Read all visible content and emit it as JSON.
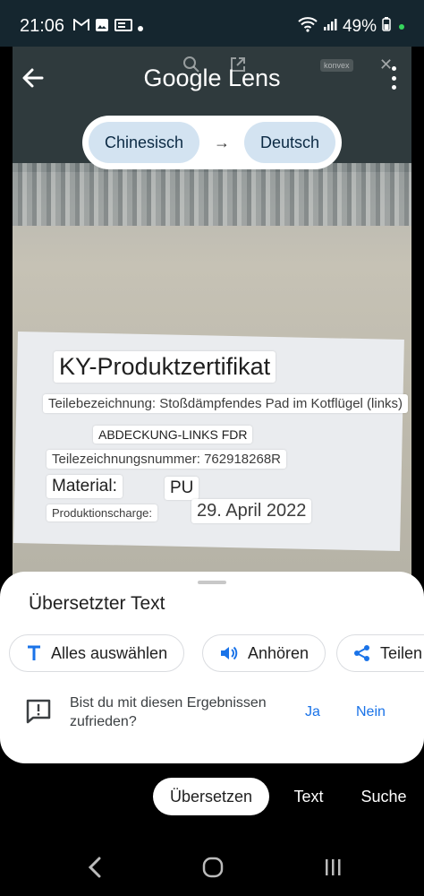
{
  "status_bar": {
    "time": "21:06",
    "battery": "49%",
    "icons": [
      "gmail-icon",
      "photo-icon",
      "gallery-icon",
      "dot-icon"
    ],
    "right_icons": [
      "wifi-icon",
      "signal-icon",
      "battery-icon"
    ]
  },
  "header": {
    "logo_text": "Google Lens",
    "faint_labels": [
      "konvex"
    ]
  },
  "language": {
    "source": "Chinesisch",
    "target": "Deutsch",
    "arrow": "→"
  },
  "overlay": {
    "title": "KY-Produktzertifikat",
    "part_name": "Teilebezeichnung: Stoßdämpfendes Pad im Kotflügel (links)",
    "cover": "ABDECKUNG-LINKS FDR",
    "part_number": "Teilezeichnungsnummer: 762918268R",
    "material_label": "Material:",
    "material_value": "PU",
    "batch_label": "Produktionscharge:",
    "date": "29. April 2022"
  },
  "sheet": {
    "title": "Übersetzter Text",
    "chips": {
      "select_all": "Alles auswählen",
      "listen": "Anhören",
      "share": "Teilen"
    },
    "feedback": {
      "question": "Bist du mit diesen Ergebnissen zufrieden?",
      "yes": "Ja",
      "no": "Nein"
    }
  },
  "tabs": {
    "translate": "Übersetzen",
    "text": "Text",
    "search": "Suche"
  },
  "colors": {
    "accent": "#1a73e8",
    "lang_chip": "#d3e3f1",
    "status_bg": "#15262f"
  }
}
